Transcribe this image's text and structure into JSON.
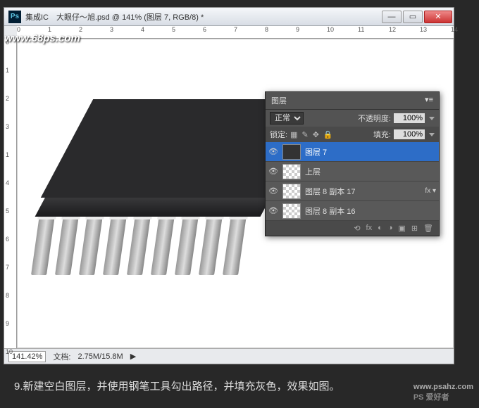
{
  "window": {
    "title": "集成IC　大眼仔～旭.psd @ 141% (图层 7, RGB/8) *",
    "min": "—",
    "max": "▭",
    "close": "✕"
  },
  "watermark": "www.68ps.com",
  "ruler_h": [
    "0",
    "1",
    "2",
    "3",
    "4",
    "5",
    "6",
    "7",
    "8",
    "9",
    "10",
    "11",
    "12",
    "13",
    "14"
  ],
  "ruler_v": [
    "0",
    "1",
    "2",
    "3",
    "1",
    "4",
    "5",
    "6",
    "7",
    "8",
    "9",
    "10"
  ],
  "panel": {
    "tab": "图层",
    "blend_label": "正常",
    "opacity_label": "不透明度:",
    "opacity_value": "100%",
    "lock_label": "锁定:",
    "fill_label": "填充:",
    "fill_value": "100%",
    "lock_icons": [
      "▦",
      "✎",
      "✥",
      "🔒"
    ]
  },
  "layers": [
    {
      "name": "图层 7",
      "selected": true,
      "fx": false,
      "dark": true
    },
    {
      "name": "上层",
      "selected": false,
      "fx": false,
      "dark": false
    },
    {
      "name": "图层 8 副本 17",
      "selected": false,
      "fx": true,
      "dark": false
    },
    {
      "name": "图层 8 副本 16",
      "selected": false,
      "fx": false,
      "dark": false
    }
  ],
  "footer_icons": [
    "⟲",
    "fx",
    "◐",
    "◑",
    "▣",
    "⊞",
    "🗑"
  ],
  "status": {
    "zoom": "141.42%",
    "doc_label": "文档:",
    "doc_value": "2.75M/15.8M"
  },
  "caption": "9.新建空白图层，并使用钢笔工具勾出路径，并填充灰色，效果如图。",
  "brand": {
    "big": "PS 爱好者",
    "small": "www.psahz.com"
  }
}
